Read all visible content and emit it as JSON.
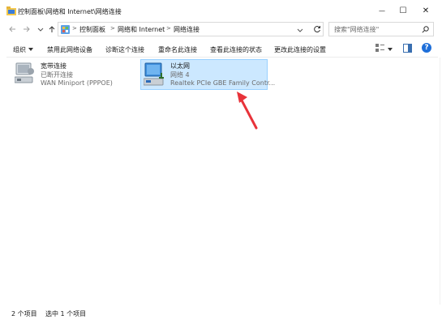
{
  "window": {
    "title": "控制面板\\网络和 Internet\\网络连接",
    "minimize_glyph": "—",
    "maximize_glyph": "☐",
    "close_glyph": "✕"
  },
  "address": {
    "crumbs": [
      "控制面板",
      "网络和 Internet",
      "网络连接"
    ],
    "search_placeholder": "搜索\"网络连接\""
  },
  "toolbar": {
    "organize": "组织",
    "items": [
      "禁用此网络设备",
      "诊断这个连接",
      "重命名此连接",
      "查看此连接的状态",
      "更改此连接的设置"
    ]
  },
  "connections": [
    {
      "name": "宽带连接",
      "status": "已断开连接",
      "device": "WAN Miniport (PPPOE)",
      "selected": false
    },
    {
      "name": "以太网",
      "status": "网络 4",
      "device": "Realtek PCIe GBE Family Contr...",
      "selected": true
    }
  ],
  "status": {
    "count": "2 个项目",
    "selected": "选中 1 个项目"
  },
  "colors": {
    "selection_bg": "#cce8ff",
    "selection_border": "#99d1ff",
    "annotation_arrow": "#e8333a",
    "help": "#1e6fd9"
  },
  "icons": [
    "folder-icon",
    "back-arrow-icon",
    "forward-arrow-icon",
    "up-arrow-icon",
    "control-panel-icon",
    "refresh-icon",
    "search-icon",
    "view-options-icon",
    "preview-pane-icon",
    "help-icon",
    "network-adapter-icon"
  ]
}
